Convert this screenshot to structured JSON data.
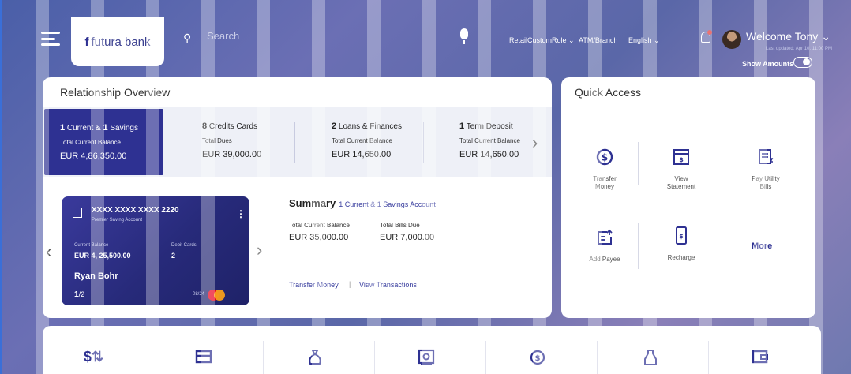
{
  "header": {
    "brand": {
      "mark": "f",
      "name": "futura bank"
    },
    "search": {
      "placeholder": "Search"
    },
    "role": "RetailCustomRole",
    "atm": "ATM/Branch",
    "language": "English",
    "welcome": "Welcome Tony",
    "last_updated": "Last updated: Apr 10, 11:00 PM",
    "show_amounts": "Show Amounts",
    "chevron": "⌄"
  },
  "relationship": {
    "title": "Relationship Overview",
    "accounts": [
      {
        "count_a": "1",
        "label_a": " Current & ",
        "count_b": "1",
        "label_b": " Savings",
        "sub": "Total Current Balance",
        "value": "EUR 4,86,350.00"
      },
      {
        "count_a": "8",
        "label_a": " Credits Cards",
        "sub": "Total Dues",
        "value": "EUR 39,000.00"
      },
      {
        "count_a": "2",
        "label_a": " Loans & Finances",
        "sub": "Total Current Balance",
        "value": "EUR 14,650.00"
      },
      {
        "count_a": "1",
        "label_a": " Term Deposit",
        "sub": "Total Current Balance",
        "value": "EUR 14,650.00"
      }
    ],
    "card": {
      "number": "XXXX XXXX XXXX 2220",
      "type": "Premier Saving Account",
      "current_label": "Current Balance",
      "current_value": "EUR 4, 25,500.00",
      "debit_label": "Debit Cards",
      "debit_value": "2",
      "holder": "Ryan Bohr",
      "page_current": "1",
      "page_total": "/2",
      "expiry": "08/24"
    },
    "summary": {
      "title": "Summary",
      "subtitle": "1 Current & 1 Savings Account",
      "balance_label": "Total Current Balance",
      "balance_value": "EUR 35,000.00",
      "bills_label": "Total Bills Due",
      "bills_value": "EUR 7,000.00",
      "link_transfer": "Transfer Money",
      "separator": "|",
      "link_transactions": "View Transactions"
    }
  },
  "quick_access": {
    "title": "Quick Access",
    "items": [
      {
        "label_1": "Transfer",
        "label_2": "Money",
        "icon": "transfer-money-icon"
      },
      {
        "label_1": "View",
        "label_2": "Statement",
        "icon": "statement-icon"
      },
      {
        "label_1": "Pay Utility",
        "label_2": "Bills",
        "icon": "bill-icon"
      },
      {
        "label_1": "Add Payee",
        "label_2": "",
        "icon": "add-payee-icon"
      },
      {
        "label_1": "Recharge",
        "label_2": "",
        "icon": "mobile-recharge-icon"
      }
    ],
    "more": "More"
  },
  "bottom_icons": [
    "exchange-icon",
    "card-icon",
    "money-bag-icon",
    "safe-icon",
    "dollar-cycle-icon",
    "jar-icon",
    "wallet-icon"
  ],
  "colors": {
    "brand": "#2e3192",
    "accent_link": "#3a3f9f",
    "mastercard_red": "#eb001b",
    "mastercard_orange": "#f79e1b"
  }
}
